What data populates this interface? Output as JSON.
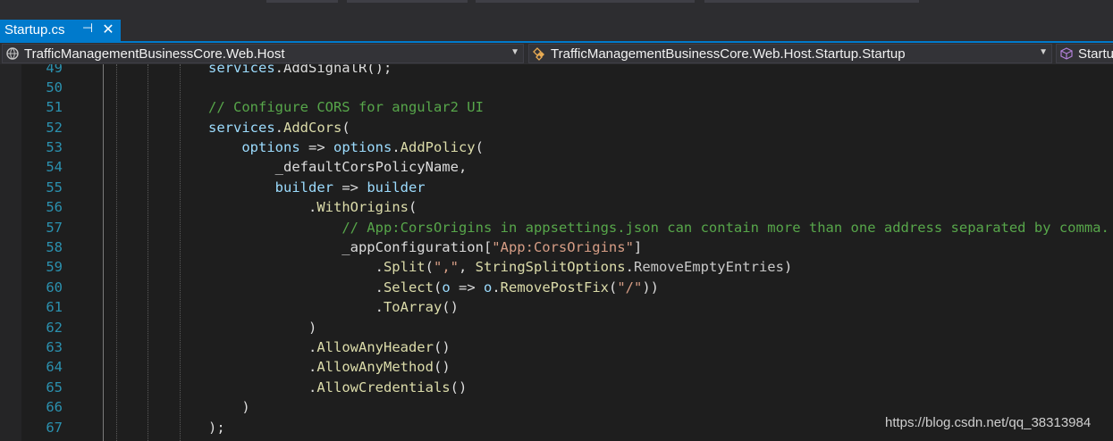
{
  "tab": {
    "title": "Startup.cs",
    "pin_glyph": "⊣",
    "close_glyph": "✕"
  },
  "navbar": {
    "project": "TrafficManagementBusinessCore.Web.Host",
    "type": "TrafficManagementBusinessCore.Web.Host.Startup.Startup",
    "member": "Startup",
    "project_icon": "project-icon",
    "type_icon": "class-icon",
    "member_icon": "method-cube-icon"
  },
  "colors": {
    "accent": "#007acc",
    "line_number": "#2b91af",
    "comment": "#57a64a",
    "method": "#dcdcaa",
    "parameter": "#9cdcfe",
    "string": "#d69d85"
  },
  "code_lines": [
    {
      "num": "49",
      "tokens": [
        {
          "t": "services",
          "c": "t-param"
        },
        {
          "t": ".AddSignalR();",
          "c": "t-plain"
        }
      ]
    },
    {
      "num": "50",
      "tokens": []
    },
    {
      "num": "51",
      "tokens": [
        {
          "t": "// Configure CORS for angular2 UI",
          "c": "t-cmt"
        }
      ]
    },
    {
      "num": "52",
      "tokens": [
        {
          "t": "services",
          "c": "t-param"
        },
        {
          "t": ".",
          "c": "t-plain"
        },
        {
          "t": "AddCors",
          "c": "t-method"
        },
        {
          "t": "(",
          "c": "t-plain"
        }
      ]
    },
    {
      "num": "53",
      "tokens": [
        {
          "t": "    ",
          "c": "t-plain"
        },
        {
          "t": "options",
          "c": "t-param"
        },
        {
          "t": " => ",
          "c": "t-plain"
        },
        {
          "t": "options",
          "c": "t-param"
        },
        {
          "t": ".",
          "c": "t-plain"
        },
        {
          "t": "AddPolicy",
          "c": "t-method"
        },
        {
          "t": "(",
          "c": "t-plain"
        }
      ]
    },
    {
      "num": "54",
      "tokens": [
        {
          "t": "        _defaultCorsPolicyName,",
          "c": "t-plain"
        }
      ]
    },
    {
      "num": "55",
      "tokens": [
        {
          "t": "        ",
          "c": "t-plain"
        },
        {
          "t": "builder",
          "c": "t-param"
        },
        {
          "t": " => ",
          "c": "t-plain"
        },
        {
          "t": "builder",
          "c": "t-param"
        }
      ]
    },
    {
      "num": "56",
      "tokens": [
        {
          "t": "            .",
          "c": "t-plain"
        },
        {
          "t": "WithOrigins",
          "c": "t-method"
        },
        {
          "t": "(",
          "c": "t-plain"
        }
      ]
    },
    {
      "num": "57",
      "tokens": [
        {
          "t": "                ",
          "c": "t-plain"
        },
        {
          "t": "// App:CorsOrigins in appsettings.json can contain more than one address separated by comma.",
          "c": "t-cmt"
        }
      ]
    },
    {
      "num": "58",
      "tokens": [
        {
          "t": "                _appConfiguration[",
          "c": "t-plain"
        },
        {
          "t": "\"App:CorsOrigins\"",
          "c": "t-str"
        },
        {
          "t": "]",
          "c": "t-plain"
        }
      ]
    },
    {
      "num": "59",
      "tokens": [
        {
          "t": "                    .",
          "c": "t-plain"
        },
        {
          "t": "Split",
          "c": "t-method"
        },
        {
          "t": "(",
          "c": "t-plain"
        },
        {
          "t": "\",\"",
          "c": "t-str"
        },
        {
          "t": ", ",
          "c": "t-plain"
        },
        {
          "t": "StringSplitOptions",
          "c": "t-method"
        },
        {
          "t": ".",
          "c": "t-plain"
        },
        {
          "t": "RemoveEmptyEntries",
          "c": "t-member"
        },
        {
          "t": ")",
          "c": "t-plain"
        }
      ]
    },
    {
      "num": "60",
      "tokens": [
        {
          "t": "                    .",
          "c": "t-plain"
        },
        {
          "t": "Select",
          "c": "t-method"
        },
        {
          "t": "(",
          "c": "t-plain"
        },
        {
          "t": "o",
          "c": "t-param"
        },
        {
          "t": " => ",
          "c": "t-plain"
        },
        {
          "t": "o",
          "c": "t-param"
        },
        {
          "t": ".",
          "c": "t-plain"
        },
        {
          "t": "RemovePostFix",
          "c": "t-method"
        },
        {
          "t": "(",
          "c": "t-plain"
        },
        {
          "t": "\"/\"",
          "c": "t-str"
        },
        {
          "t": "))",
          "c": "t-plain"
        }
      ]
    },
    {
      "num": "61",
      "tokens": [
        {
          "t": "                    .",
          "c": "t-plain"
        },
        {
          "t": "ToArray",
          "c": "t-method"
        },
        {
          "t": "()",
          "c": "t-plain"
        }
      ]
    },
    {
      "num": "62",
      "tokens": [
        {
          "t": "            )",
          "c": "t-plain"
        }
      ]
    },
    {
      "num": "63",
      "tokens": [
        {
          "t": "            .",
          "c": "t-plain"
        },
        {
          "t": "AllowAnyHeader",
          "c": "t-method"
        },
        {
          "t": "()",
          "c": "t-plain"
        }
      ]
    },
    {
      "num": "64",
      "tokens": [
        {
          "t": "            .",
          "c": "t-plain"
        },
        {
          "t": "AllowAnyMethod",
          "c": "t-method"
        },
        {
          "t": "()",
          "c": "t-plain"
        }
      ]
    },
    {
      "num": "65",
      "tokens": [
        {
          "t": "            .",
          "c": "t-plain"
        },
        {
          "t": "AllowCredentials",
          "c": "t-method"
        },
        {
          "t": "()",
          "c": "t-plain"
        }
      ]
    },
    {
      "num": "66",
      "tokens": [
        {
          "t": "    )",
          "c": "t-plain"
        }
      ]
    },
    {
      "num": "67",
      "tokens": [
        {
          "t": ");",
          "c": "t-plain"
        }
      ]
    }
  ],
  "watermark": "https://blog.csdn.net/qq_38313984"
}
